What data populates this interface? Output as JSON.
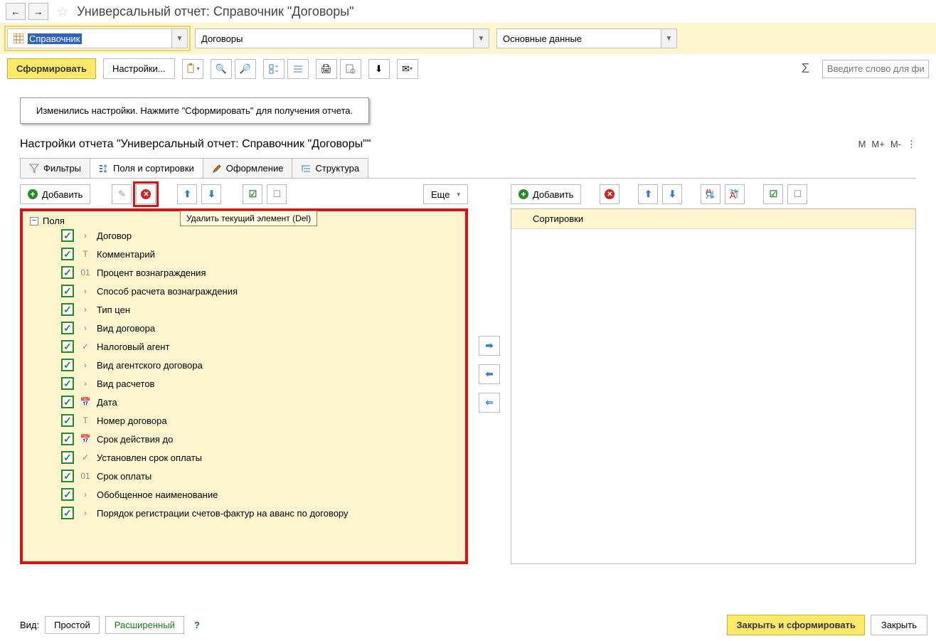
{
  "header": {
    "page_title": "Универсальный отчет: Справочник \"Договоры\""
  },
  "selectors": {
    "type_value": "Справочник",
    "object_value": "Договоры",
    "variant_value": "Основные данные"
  },
  "toolbar": {
    "generate": "Сформировать",
    "settings": "Настройки...",
    "search_placeholder": "Введите слово для фил",
    "sigma": "Σ"
  },
  "hint": {
    "text": "Изменились настройки. Нажмите \"Сформировать\" для получения отчета."
  },
  "settings": {
    "title": "Настройки отчета \"Универсальный отчет: Справочник \"Договоры\"\"",
    "mem": {
      "m": "M",
      "mplus": "M+",
      "mminus": "M-"
    },
    "tabs": {
      "filters": "Фильтры",
      "fields": "Поля и сортировки",
      "appearance": "Оформление",
      "structure": "Структура"
    }
  },
  "pane": {
    "add": "Добавить",
    "more": "Еще",
    "tooltip": "Удалить текущий элемент (Del)",
    "fields_root": "Поля",
    "sort_root": "Сортировки",
    "items": [
      {
        "label": "Договор",
        "icon": "ref"
      },
      {
        "label": "Комментарий",
        "icon": "text"
      },
      {
        "label": "Процент вознаграждения",
        "icon": "num"
      },
      {
        "label": "Способ расчета вознаграждения",
        "icon": "ref"
      },
      {
        "label": "Тип цен",
        "icon": "ref"
      },
      {
        "label": "Вид договора",
        "icon": "ref"
      },
      {
        "label": "Налоговый агент",
        "icon": "bool"
      },
      {
        "label": "Вид агентского договора",
        "icon": "ref"
      },
      {
        "label": "Вид расчетов",
        "icon": "ref"
      },
      {
        "label": "Дата",
        "icon": "date"
      },
      {
        "label": "Номер договора",
        "icon": "text"
      },
      {
        "label": "Срок действия до",
        "icon": "date"
      },
      {
        "label": "Установлен срок оплаты",
        "icon": "bool"
      },
      {
        "label": "Срок оплаты",
        "icon": "num"
      },
      {
        "label": "Обобщенное наименование",
        "icon": "ref"
      },
      {
        "label": "Порядок регистрации счетов-фактур на аванс по договору",
        "icon": "ref"
      }
    ]
  },
  "footer": {
    "view_label": "Вид:",
    "simple": "Простой",
    "advanced": "Расширенный",
    "close_generate": "Закрыть и сформировать",
    "close": "Закрыть"
  }
}
